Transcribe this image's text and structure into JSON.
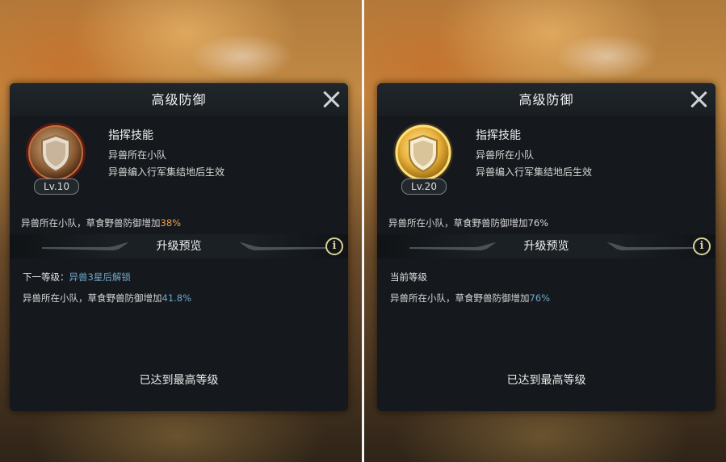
{
  "left": {
    "title": "高级防御",
    "level_label": "Lv.10",
    "skill_type": "指挥技能",
    "skill_line1": "异兽所在小队",
    "skill_line2": "异兽编入行军集结地后生效",
    "effect_prefix": "异兽所在小队，草食野兽防御增加",
    "effect_value": "38%",
    "section_title": "升级预览",
    "next_label": "下一等级：",
    "next_lock": "异兽3星后解锁",
    "next_effect_prefix": "异兽所在小队，草食野兽防御增加",
    "next_effect_value": "41.8%",
    "max_text": "已达到最高等级"
  },
  "right": {
    "title": "高级防御",
    "level_label": "Lv.20",
    "skill_type": "指挥技能",
    "skill_line1": "异兽所在小队",
    "skill_line2": "异兽编入行军集结地后生效",
    "effect_prefix": "异兽所在小队，草食野兽防御增加",
    "effect_value": "76%",
    "section_title": "升级预览",
    "current_label": "当前等级",
    "current_effect_prefix": "异兽所在小队，草食野兽防御增加",
    "current_effect_value": "76%",
    "max_text": "已达到最高等级"
  },
  "icons": {
    "close": "close-icon",
    "info": "info-icon",
    "skill": "shield-icon"
  },
  "colors": {
    "panel_bg": "#15191d",
    "value_orange": "#e8a052",
    "value_blue": "#6fa6c9",
    "gold": "#f2c24a"
  }
}
